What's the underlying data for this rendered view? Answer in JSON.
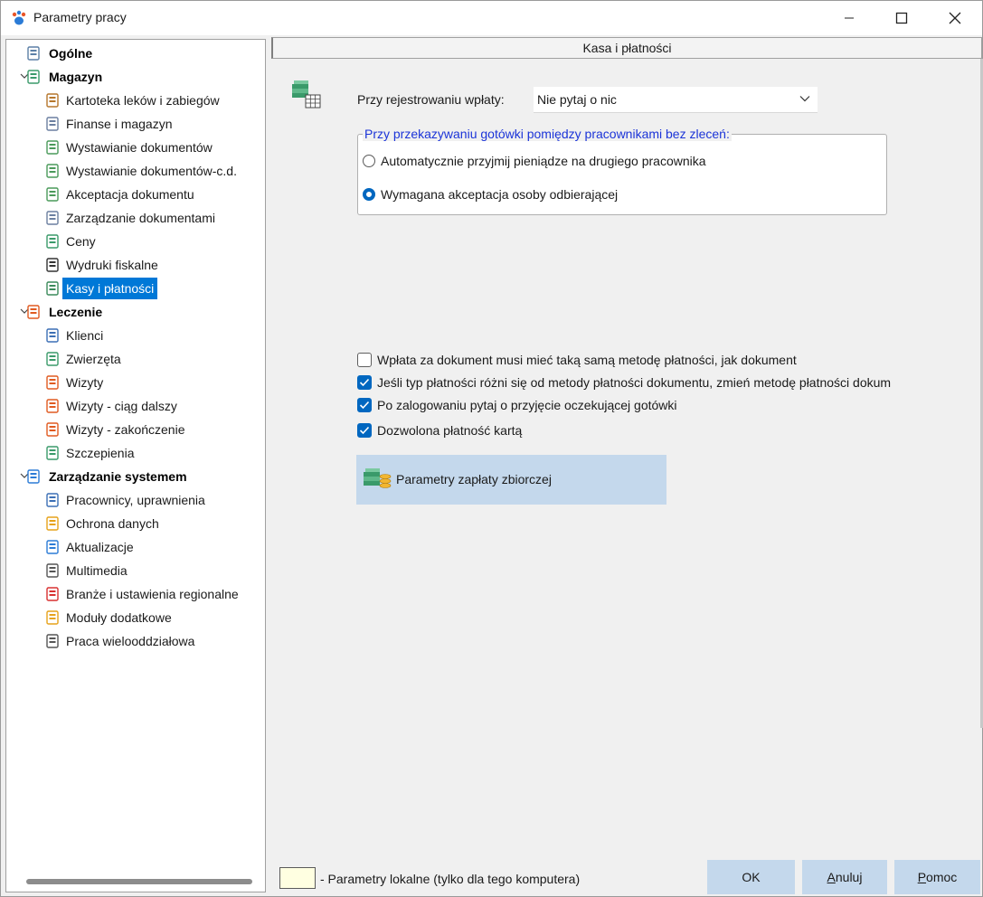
{
  "window": {
    "title": "Parametry pracy"
  },
  "tree": {
    "nodes": [
      {
        "label": "Ogólne",
        "icon": "monitor-settings-icon"
      },
      {
        "label": "Magazyn",
        "icon": "warehouse-icon"
      },
      {
        "label": "Kartoteka leków i zabiegów",
        "icon": "medicine-bottle-icon"
      },
      {
        "label": "Finanse i magazyn",
        "icon": "ledger-icon"
      },
      {
        "label": "Wystawianie dokumentów",
        "icon": "document-add-icon"
      },
      {
        "label": "Wystawianie dokumentów-c.d.",
        "icon": "document-add-icon"
      },
      {
        "label": "Akceptacja dokumentu",
        "icon": "document-check-icon"
      },
      {
        "label": "Zarządzanie dokumentami",
        "icon": "documents-icon"
      },
      {
        "label": "Ceny",
        "icon": "money-stack-icon"
      },
      {
        "label": "Wydruki fiskalne",
        "icon": "fiscal-printer-icon"
      },
      {
        "label": "Kasy i płatności",
        "icon": "cash-register-icon"
      },
      {
        "label": "Leczenie",
        "icon": "clipboard-icon"
      },
      {
        "label": "Klienci",
        "icon": "person-icon"
      },
      {
        "label": "Zwierzęta",
        "icon": "paw-icon"
      },
      {
        "label": "Wizyty",
        "icon": "clipboard-check-icon"
      },
      {
        "label": "Wizyty - ciąg dalszy",
        "icon": "clipboard-check-icon"
      },
      {
        "label": "Wizyty - zakończenie",
        "icon": "clipboard-check-icon"
      },
      {
        "label": "Szczepienia",
        "icon": "syringe-icon"
      },
      {
        "label": "Zarządzanie systemem",
        "icon": "system-icon"
      },
      {
        "label": "Pracownicy, uprawnienia",
        "icon": "users-settings-icon"
      },
      {
        "label": "Ochrona danych",
        "icon": "lock-icon"
      },
      {
        "label": "Aktualizacje",
        "icon": "update-icon"
      },
      {
        "label": "Multimedia",
        "icon": "multimedia-icon"
      },
      {
        "label": "Branże i ustawienia regionalne",
        "icon": "flag-icon"
      },
      {
        "label": "Moduły dodatkowe",
        "icon": "module-add-icon"
      },
      {
        "label": "Praca wielooddziałowa",
        "icon": "home-icon"
      }
    ]
  },
  "panel": {
    "header": "Kasa i płatności",
    "payment_label": "Przy rejestrowaniu wpłaty:",
    "payment_value": "Nie pytaj o nic",
    "group_title": "Przy przekazywaniu gotówki pomiędzy pracownikami bez zleceń:",
    "radio_auto": "Automatycznie przyjmij pieniądze na drugiego pracownika",
    "radio_accept": "Wymagana akceptacja osoby odbierającej",
    "check_same_method": "Wpłata za dokument musi mieć taką samą metodę płatności, jak dokument",
    "check_change_method": "Jeśli typ płatności różni się od metody płatności dokumentu, zmień metodę płatności dokum",
    "check_pending_cash": "Po zalogowaniu pytaj o przyjęcie oczekującej gotówki",
    "check_card": "Dozwolona płatność kartą",
    "collective_button": "Parametry zapłaty zbiorczej"
  },
  "footer": {
    "legend": "- Parametry lokalne (tylko dla tego komputera)",
    "ok": "OK",
    "cancel_pre": "",
    "cancel_u": "A",
    "cancel_post": "nuluj",
    "help_pre": "",
    "help_u": "P",
    "help_post": "omoc"
  },
  "colors": {
    "accent": "#0067c0",
    "selection": "#0078d7",
    "button": "#c4d8ec",
    "group_title": "#1b34d8",
    "local_param": "#ffffe1"
  }
}
